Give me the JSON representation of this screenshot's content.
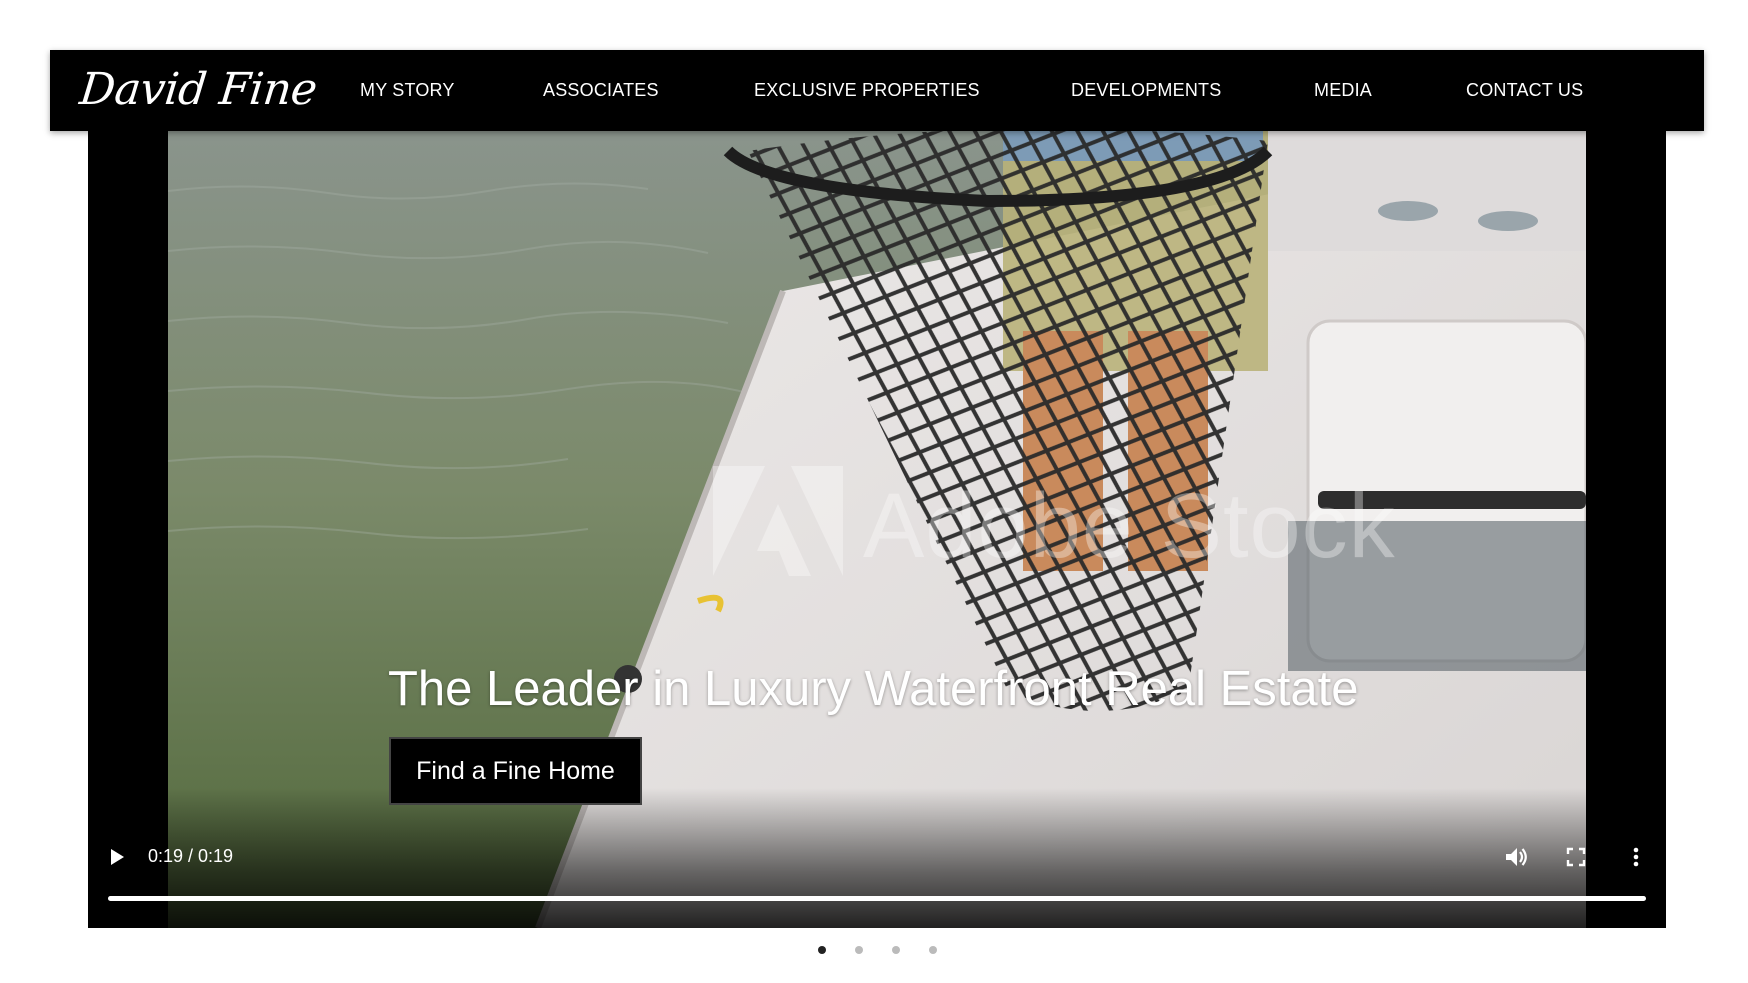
{
  "header": {
    "logo_text": "David Fine",
    "nav_items": [
      {
        "label": "MY STORY"
      },
      {
        "label": "ASSOCIATES"
      },
      {
        "label": "EXCLUSIVE PROPERTIES"
      },
      {
        "label": "DEVELOPMENTS"
      },
      {
        "label": "MEDIA"
      },
      {
        "label": "CONTACT US"
      }
    ]
  },
  "hero": {
    "headline": "The Leader in Luxury Waterfront Real Estate",
    "cta_label": "Find a Fine Home",
    "watermark_text": "Adobe Stock"
  },
  "video_player": {
    "time_display": "0:19 / 0:19",
    "progress_fraction": 1.0,
    "icons": {
      "play": "play-icon",
      "volume": "volume-icon",
      "fullscreen": "fullscreen-icon",
      "more": "more-vertical-icon"
    }
  },
  "carousel": {
    "dot_count": 4,
    "active_index": 0
  },
  "colors": {
    "nav_background": "#000000",
    "nav_text": "#ffffff",
    "cta_background": "#000000",
    "dot_active": "#222222",
    "dot_inactive": "#bbbbbb"
  }
}
